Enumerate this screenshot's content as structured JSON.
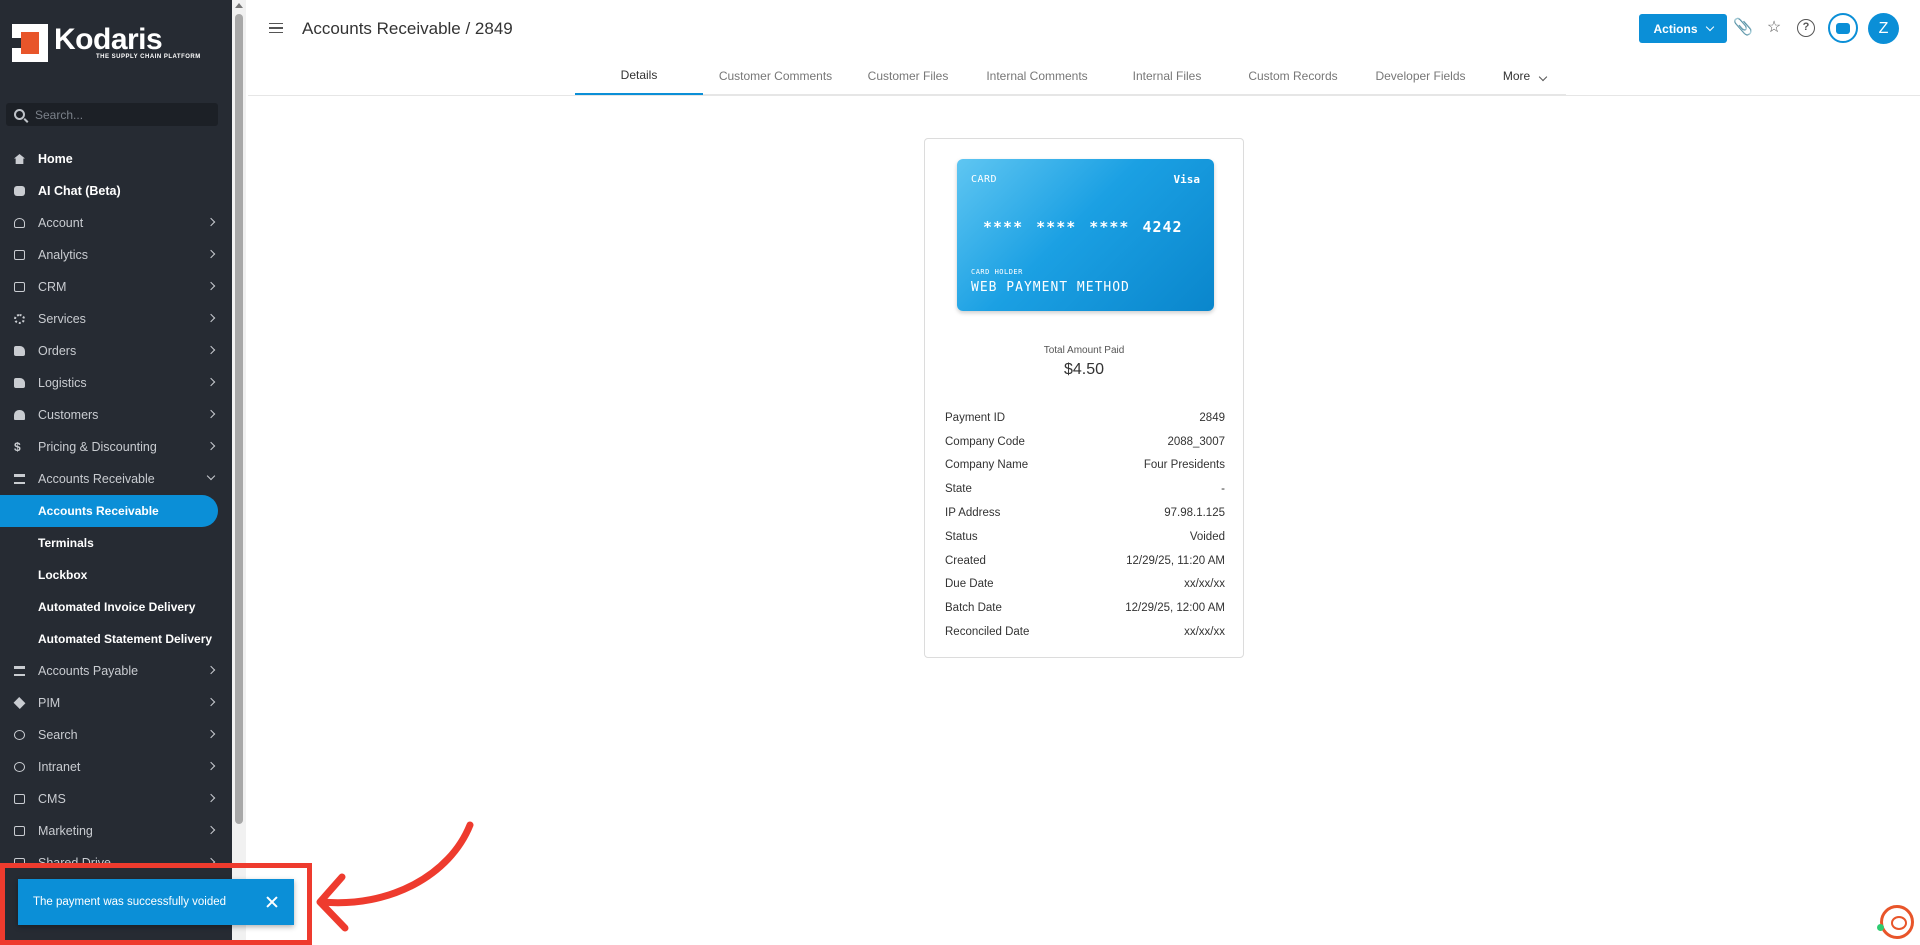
{
  "app": {
    "name": "Kodaris",
    "tagline": "THE SUPPLY CHAIN PLATFORM"
  },
  "search": {
    "placeholder": "Search..."
  },
  "sidebar": {
    "items": [
      {
        "label": "Home"
      },
      {
        "label": "AI Chat (Beta)"
      },
      {
        "label": "Account"
      },
      {
        "label": "Analytics"
      },
      {
        "label": "CRM"
      },
      {
        "label": "Services"
      },
      {
        "label": "Orders"
      },
      {
        "label": "Logistics"
      },
      {
        "label": "Customers"
      },
      {
        "label": "Pricing & Discounting"
      },
      {
        "label": "Accounts Receivable"
      }
    ],
    "sub_items": [
      {
        "label": "Accounts Receivable"
      },
      {
        "label": "Terminals"
      },
      {
        "label": "Lockbox"
      },
      {
        "label": "Automated Invoice Delivery"
      },
      {
        "label": "Automated Statement Delivery"
      }
    ],
    "items_after": [
      {
        "label": "Accounts Payable"
      },
      {
        "label": "PIM"
      },
      {
        "label": "Search"
      },
      {
        "label": "Intranet"
      },
      {
        "label": "CMS"
      },
      {
        "label": "Marketing"
      },
      {
        "label": "Shared Drive"
      }
    ]
  },
  "header": {
    "title": "Accounts Receivable / 2849",
    "actions_label": "Actions",
    "avatar_initial": "Z"
  },
  "tabs": [
    {
      "label": "Details"
    },
    {
      "label": "Customer Comments"
    },
    {
      "label": "Customer Files"
    },
    {
      "label": "Internal Comments"
    },
    {
      "label": "Internal Files"
    },
    {
      "label": "Custom Records"
    },
    {
      "label": "Developer Fields"
    },
    {
      "label": "More"
    }
  ],
  "card": {
    "type": "CARD",
    "brand": "Visa",
    "number": "**** **** **** 4242",
    "holder_label": "CARD HOLDER",
    "holder": "WEB PAYMENT METHOD"
  },
  "total": {
    "label": "Total Amount Paid",
    "value": "$4.50"
  },
  "details": [
    {
      "label": "Payment ID",
      "value": "2849"
    },
    {
      "label": "Company Code",
      "value": "2088_3007"
    },
    {
      "label": "Company Name",
      "value": "Four Presidents"
    },
    {
      "label": "State",
      "value": "-"
    },
    {
      "label": "IP Address",
      "value": "97.98.1.125"
    },
    {
      "label": "Status",
      "value": "Voided"
    },
    {
      "label": "Created",
      "value": "12/29/25, 11:20 AM"
    },
    {
      "label": "Due Date",
      "value": "xx/xx/xx"
    },
    {
      "label": "Batch Date",
      "value": "12/29/25, 12:00 AM"
    },
    {
      "label": "Reconciled Date",
      "value": "xx/xx/xx"
    }
  ],
  "toast": {
    "message": "The payment was successfully voided"
  },
  "colors": {
    "accent": "#0b8fd7",
    "sidebar": "#262b33",
    "highlight": "#ee3b2e"
  }
}
